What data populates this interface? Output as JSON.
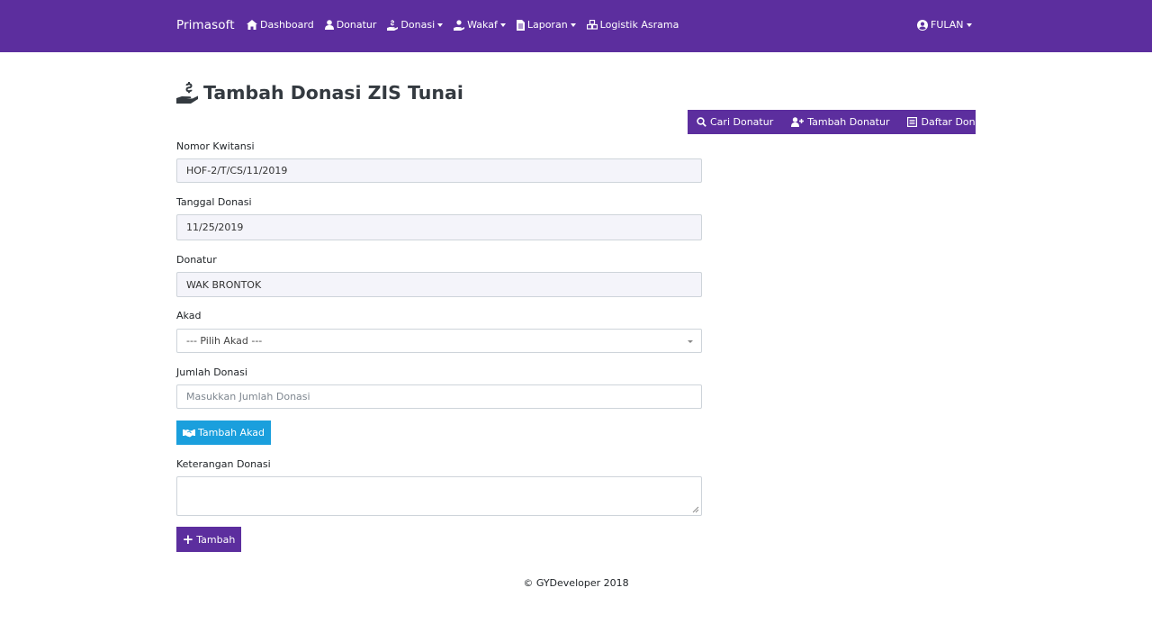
{
  "navbar": {
    "brand": "Primasoft",
    "items": [
      {
        "label": "Dashboard",
        "icon": "home-icon",
        "dropdown": false
      },
      {
        "label": "Donatur",
        "icon": "user-icon",
        "dropdown": false
      },
      {
        "label": "Donasi",
        "icon": "hand-holding-usd-icon",
        "dropdown": true
      },
      {
        "label": "Wakaf",
        "icon": "hand-holding-icon",
        "dropdown": true
      },
      {
        "label": "Laporan",
        "icon": "file-icon",
        "dropdown": true
      },
      {
        "label": "Logistik Asrama",
        "icon": "cubes-icon",
        "dropdown": false
      }
    ],
    "user": "FULAN"
  },
  "page": {
    "title": "Tambah Donasi ZIS Tunai",
    "title_icon": "hand-holding-usd-icon"
  },
  "actions": {
    "cari_donatur": "Cari Donatur",
    "tambah_donatur": "Tambah Donatur",
    "daftar_donasi": "Daftar Donasi"
  },
  "form": {
    "nomor_kwitansi": {
      "label": "Nomor Kwitansi",
      "value": "HOF-2/T/CS/11/2019"
    },
    "tanggal_donasi": {
      "label": "Tanggal Donasi",
      "value": "11/25/2019"
    },
    "donatur": {
      "label": "Donatur",
      "value": "WAK BRONTOK"
    },
    "akad": {
      "label": "Akad",
      "value": "--- Pilih Akad ---"
    },
    "jumlah_donasi": {
      "label": "Jumlah Donasi",
      "placeholder": "Masukkan Jumlah Donasi"
    },
    "tambah_akad_button": "Tambah Akad",
    "keterangan_donasi": {
      "label": "Keterangan Donasi",
      "value": ""
    },
    "tambah_button": "Tambah"
  },
  "footer": {
    "copyright": "© GYDeveloper 2018"
  },
  "colors": {
    "primary": "#5c2e9e",
    "info": "#1a9fdd"
  }
}
